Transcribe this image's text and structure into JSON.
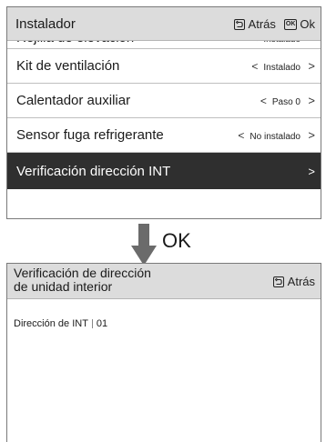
{
  "screen1": {
    "header": {
      "title": "Instalador",
      "back_label": "Atrás",
      "ok_icon_text": "OK",
      "ok_label": "Ok"
    },
    "items": [
      {
        "label": "Rejilla de elevación",
        "value": "Instalado"
      },
      {
        "label": "Kit de ventilación",
        "value": "Instalado"
      },
      {
        "label": "Calentador auxiliar",
        "value": "Paso 0"
      },
      {
        "label": "Sensor fuga refrigerante",
        "value": "No instalado"
      },
      {
        "label": "Verificación dirección INT",
        "value": ""
      }
    ]
  },
  "transition": {
    "label": "OK"
  },
  "screen2": {
    "header": {
      "title_line1": "Verificación de dirección",
      "title_line2": "de unidad interior",
      "back_label": "Atrás"
    },
    "content": {
      "label": "Dirección de INT",
      "value": "01"
    }
  },
  "colors": {
    "header_bg": "#dcdcdc",
    "selected_row_bg": "#2f2f2f",
    "arrow": "#6b6b6b"
  },
  "icons": [
    "back-icon",
    "ok-icon",
    "chevron-left-icon",
    "chevron-right-icon",
    "down-arrow-icon"
  ]
}
